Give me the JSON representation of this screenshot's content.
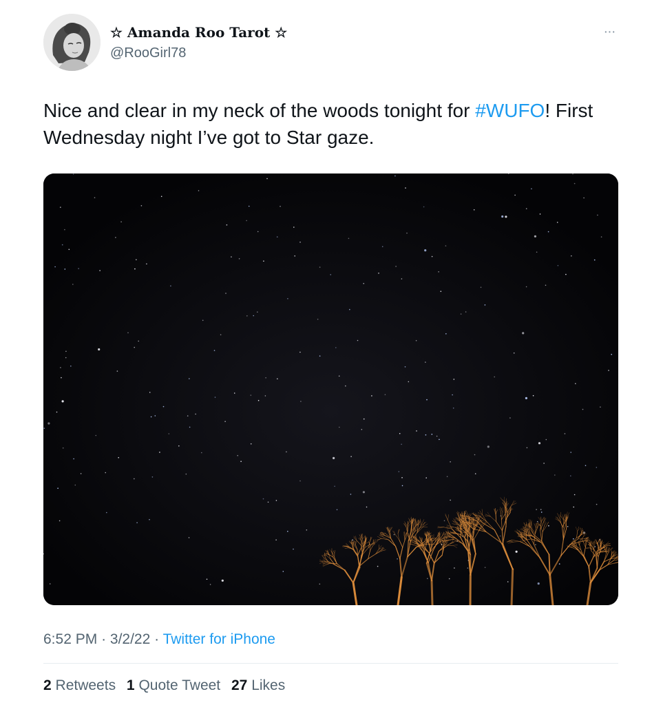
{
  "tweet": {
    "display_name": "☆ Amanda Roo Tarot ☆",
    "handle": "@RooGirl78",
    "text_before": "Nice and clear in my neck of the woods tonight for ",
    "hashtag": "#WUFO",
    "text_after": "! First Wednesday night I’ve got to Star gaze.",
    "time": "6:52 PM",
    "date": "3/2/22",
    "source": "Twitter for iPhone",
    "more_icon": "ellipsis-icon",
    "media_alt": "night-sky-photo"
  },
  "stats": {
    "retweets_count": "2",
    "retweets_label": "Retweets",
    "quotes_count": "1",
    "quotes_label": "Quote Tweet",
    "likes_count": "27",
    "likes_label": "Likes"
  },
  "colors": {
    "link": "#1d9bf0",
    "secondary_text": "#536471",
    "primary_text": "#0f1419",
    "sky": "#06060a",
    "trees": "#d98a3a"
  }
}
